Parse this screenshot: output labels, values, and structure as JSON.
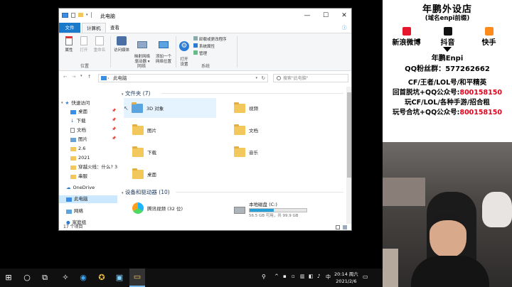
{
  "window": {
    "title": "此电脑",
    "controls": [
      "—",
      "☐",
      "✕"
    ]
  },
  "ribbon": {
    "tabs": [
      {
        "label": "文件"
      },
      {
        "label": "计算机"
      },
      {
        "label": "查看"
      }
    ],
    "location_group": {
      "label": "位置",
      "buttons": [
        "属性",
        "打开",
        "重命名"
      ]
    },
    "network_group": {
      "label": "网络",
      "buttons": [
        "访问媒体",
        "映射网络\n驱动器 ▾",
        "添加一个\n网络位置"
      ]
    },
    "system_group": {
      "label": "系统",
      "open_settings": "打开\n设置",
      "items": [
        "卸载或更改程序",
        "系统属性",
        "管理"
      ]
    }
  },
  "address": {
    "path": "此电脑",
    "search_placeholder": "搜索\"此电脑\""
  },
  "nav": {
    "quick_access": "快速访问",
    "items": [
      {
        "label": "桌面",
        "pinned": true
      },
      {
        "label": "下载",
        "pinned": true
      },
      {
        "label": "文档",
        "pinned": true
      },
      {
        "label": "图片",
        "pinned": true
      },
      {
        "label": "2.6",
        "pinned": false
      },
      {
        "label": "2021",
        "pinned": false
      },
      {
        "label": "穿越火线：什么? 3",
        "pinned": false
      },
      {
        "label": "串服",
        "pinned": false
      }
    ],
    "onedrive": "OneDrive",
    "this_pc": "此电脑",
    "network": "网络",
    "homegroup": "家庭组"
  },
  "main": {
    "folders_header": "文件夹 (7)",
    "folders": [
      {
        "label": "3D 对象"
      },
      {
        "label": "视频"
      },
      {
        "label": "图片"
      },
      {
        "label": "文档"
      },
      {
        "label": "下载"
      },
      {
        "label": "音乐"
      },
      {
        "label": "桌面"
      }
    ],
    "drives_header": "设备和驱动器 (10)",
    "drives": [
      {
        "label": "腾讯视频 (32 位)",
        "detail": ""
      },
      {
        "label": "本地磁盘 (C:)",
        "detail": "56.5 GB 可用，共 99.9 GB",
        "used_fraction": 0.43
      }
    ]
  },
  "status": {
    "count": "17 个项目"
  },
  "taskbar": {
    "time": "20:14 周六",
    "date": "2021/2/6"
  },
  "panel": {
    "title": "年鹏外设店",
    "subtitle": "(域名enpi前缀)",
    "social": [
      "新浪微博",
      "抖音",
      "快手"
    ],
    "name": "年鹏Enpi",
    "qq_label": "QQ粉丝群：",
    "qq_number": "577262662",
    "line1": "CF/王者/LOL号/和平精英",
    "line2_a": "回首脱坑+QQ公众号:",
    "line2_b": "800158150",
    "line3": "玩CF/LOL/各种手游/招合租",
    "line4_a": "玩号合坑+QQ公众号:",
    "line4_b": "800158150",
    "colors": {
      "weibo": "#e6162d",
      "douyin": "#111111",
      "kuaishou": "#ff8c1a",
      "accent_red": "#e0001b"
    }
  }
}
